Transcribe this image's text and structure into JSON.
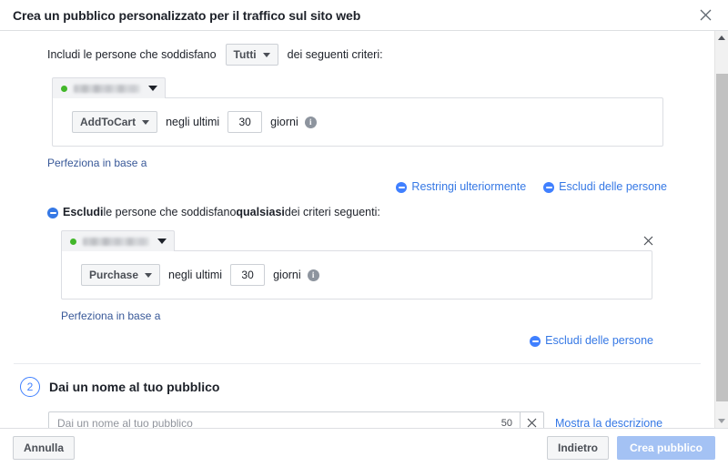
{
  "header": {
    "title": "Crea un pubblico personalizzato per il traffico sul sito web",
    "close_icon": "close-icon"
  },
  "include_section": {
    "prefix_label": "Includi le persone che soddisfano",
    "operator": "Tutti",
    "suffix_label": "dei seguenti criteri:",
    "pixel": {
      "name": "",
      "status": "active",
      "status_color": "#42b72a"
    },
    "rule": {
      "event": "AddToCart",
      "middle_label": "negli ultimi",
      "days": "30",
      "days_label": "giorni",
      "info_icon": "info-icon"
    },
    "refine_link": "Perfeziona in base a",
    "narrow_link": "Restringi ulteriormente",
    "exclude_link": "Escludi delle persone"
  },
  "exclude_section": {
    "heading_bold": "Escludi",
    "heading_middle": " le persone che soddisfano ",
    "heading_bold2": "qualsiasi",
    "heading_end": " dei criteri seguenti:",
    "pixel": {
      "name": "",
      "status": "active",
      "status_color": "#42b72a"
    },
    "rule": {
      "event": "Purchase",
      "middle_label": "negli ultimi",
      "days": "30",
      "days_label": "giorni",
      "info_icon": "info-icon"
    },
    "refine_link": "Perfeziona in base a",
    "remove_icon": "close-icon",
    "exclude_link": "Escludi delle persone"
  },
  "step2": {
    "number": "2",
    "title": "Dai un nome al tuo pubblico",
    "name_value": "",
    "name_placeholder": "Dai un nome al tuo pubblico",
    "char_count": "50",
    "clear_icon": "close-icon",
    "description_link": "Mostra la descrizione"
  },
  "footer": {
    "cancel": "Annulla",
    "back": "Indietro",
    "create": "Crea pubblico"
  },
  "colors": {
    "accent_blue": "#4080ff",
    "link_blue": "#3578e5",
    "status_green": "#42b72a",
    "primary_disabled": "#a4c2f4"
  }
}
